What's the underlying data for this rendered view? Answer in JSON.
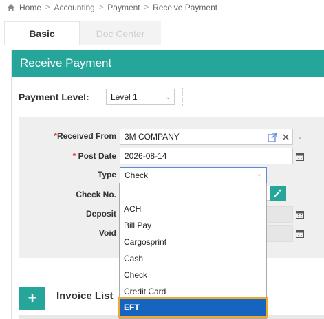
{
  "breadcrumb": {
    "items": [
      "Home",
      "Accounting",
      "Payment",
      "Receive Payment"
    ],
    "separator": ">"
  },
  "tabs": [
    {
      "label": "Basic",
      "active": true
    },
    {
      "label": "Doc Center",
      "active": false
    }
  ],
  "panel": {
    "title": "Receive Payment",
    "accent_color": "#26a69a"
  },
  "payment_level": {
    "label": "Payment Level:",
    "value": "Level 1"
  },
  "form": {
    "received_from": {
      "required_mark": "*",
      "label": "Received From",
      "value": "3M COMPANY"
    },
    "post_date": {
      "required_mark": "*",
      "label": "Post Date",
      "value": "2026-08-14"
    },
    "type": {
      "label": "Type",
      "value": "Check"
    },
    "check_no": {
      "label": "Check No."
    },
    "deposit": {
      "label": "Deposit"
    },
    "void": {
      "label": "Void"
    }
  },
  "type_dropdown": {
    "options": [
      "",
      "ACH",
      "Bill Pay",
      "Cargosprint",
      "Cash",
      "Check",
      "Credit Card",
      "EFT"
    ],
    "highlighted": "EFT",
    "highlight_color": "#1565c0",
    "outline_color": "#f0a92e"
  },
  "invoice_list": {
    "add_label": "+",
    "title": "Invoice List"
  }
}
